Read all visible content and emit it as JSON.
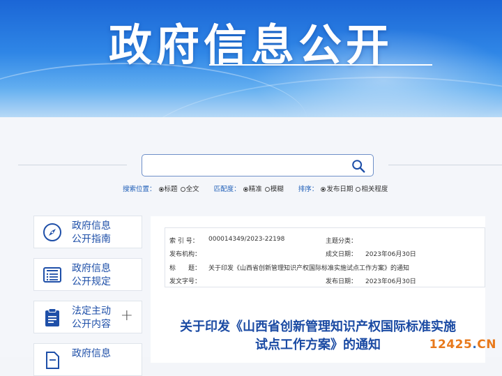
{
  "banner": {
    "title": "政府信息公开"
  },
  "search": {
    "placeholder": "",
    "position_label": "搜索位置：",
    "position_options": [
      "标题",
      "全文"
    ],
    "match_label": "匹配度：",
    "match_options": [
      "精准",
      "模糊"
    ],
    "sort_label": "排序：",
    "sort_options": [
      "发布日期",
      "相关程度"
    ]
  },
  "sidebar": {
    "items": [
      {
        "line1": "政府信息",
        "line2": "公开指南",
        "icon": "compass-icon"
      },
      {
        "line1": "政府信息",
        "line2": "公开规定",
        "icon": "document-list-icon"
      },
      {
        "line1": "法定主动",
        "line2": "公开内容",
        "icon": "clipboard-icon",
        "expand": "+"
      },
      {
        "line1": "政府信息",
        "line2": "",
        "icon": "file-icon"
      }
    ]
  },
  "meta": {
    "index_label": "索 引 号：",
    "index_value": "000014349/2023-22198",
    "subject_label": "主题分类：",
    "subject_value": "",
    "org_label": "发布机构：",
    "org_value": "",
    "created_label": "成文日期：",
    "created_value": "2023年06月30日",
    "title_label": "标　　题：",
    "title_value": "关于印发《山西省创新管理知识产权国际标准实施试点工作方案》的通知",
    "docno_label": "发文字号：",
    "docno_value": "",
    "published_label": "发布日期：",
    "published_value": "2023年06月30日"
  },
  "document": {
    "title_line1": "关于印发《山西省创新管理知识产权国际标准实施",
    "title_line2": "试点工作方案》的通知"
  },
  "watermark": {
    "part1": "12425",
    "dot": ".",
    "part2": "CN"
  },
  "colors": {
    "accent": "#1e4fa8",
    "banner": "#2f86e6"
  }
}
